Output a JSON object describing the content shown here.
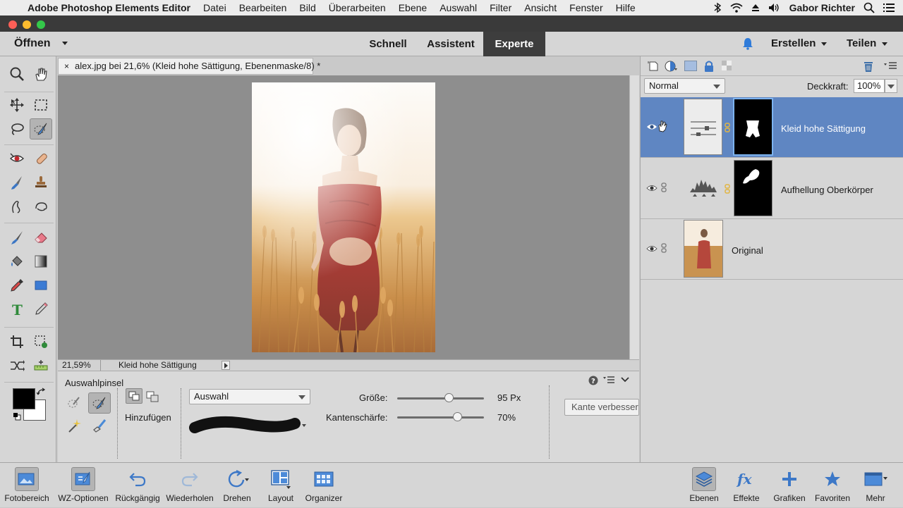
{
  "menubar": {
    "app_name": "Adobe Photoshop Elements Editor",
    "items": [
      "Datei",
      "Bearbeiten",
      "Bild",
      "Überarbeiten",
      "Ebene",
      "Auswahl",
      "Filter",
      "Ansicht",
      "Fenster",
      "Hilfe"
    ],
    "user": "Gabor Richter"
  },
  "appbar": {
    "open_label": "Öffnen",
    "modes": [
      "Schnell",
      "Assistent",
      "Experte"
    ],
    "active_mode": "Experte",
    "create_label": "Erstellen",
    "share_label": "Teilen"
  },
  "document": {
    "tab_title": "alex.jpg bei 21,6% (Kleid hohe Sättigung, Ebenenmaske/8) *",
    "zoom": "21,59%",
    "status_info": "Kleid hohe Sättigung"
  },
  "tool_options": {
    "tool_name": "Auswahlpinsel",
    "mode_label": "Hinzufügen",
    "selection_mode": "Auswahl",
    "size_label": "Größe:",
    "size_value": "95 Px",
    "size_fraction": 0.6,
    "feather_label": "Kantenschärfe:",
    "feather_value": "70%",
    "feather_fraction": 0.7,
    "refine_button": "Kante verbesser..."
  },
  "layers_panel": {
    "blend_mode": "Normal",
    "opacity_label": "Deckkraft:",
    "opacity_value": "100%",
    "layers": [
      {
        "name": "Kleid hohe Sättigung",
        "selected": true
      },
      {
        "name": "Aufhellung Oberkörper",
        "selected": false
      },
      {
        "name": "Original",
        "selected": false
      }
    ]
  },
  "bottombar": {
    "left": [
      "Fotobereich",
      "WZ-Optionen",
      "Rückgängig",
      "Wiederholen",
      "Drehen",
      "Layout",
      "Organizer"
    ],
    "right": [
      "Ebenen",
      "Effekte",
      "Grafiken",
      "Favoriten",
      "Mehr"
    ]
  },
  "colors": {
    "selected_layer": "#5f86c2",
    "accent_blue": "#3d78c7"
  }
}
